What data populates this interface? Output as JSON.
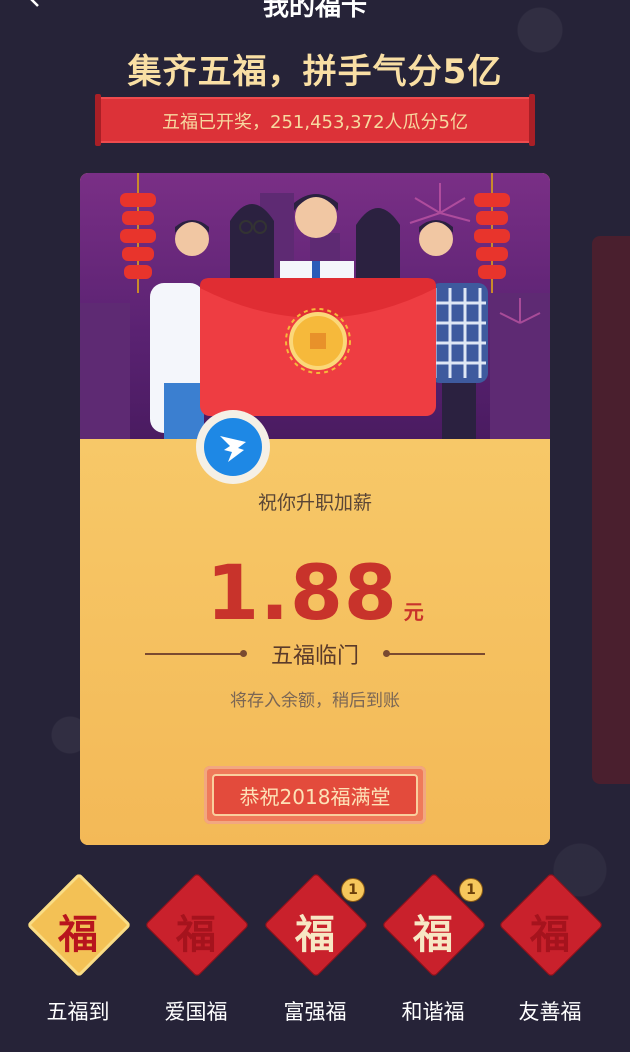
{
  "nav": {
    "title": "我的福卡",
    "back_icon": "chevron-left-icon"
  },
  "headline": "集齐五福，拼手气分5亿",
  "ribbon": "五福已开奖，251,453,372人瓜分5亿",
  "card": {
    "logo_icon": "dingtalk-wing-icon",
    "blessing": "祝你升职加薪",
    "amount": "1.88",
    "unit": "元",
    "subtitle": "五福临门",
    "note": "将存入余额，稍后到账",
    "button": "恭祝2018福满堂"
  },
  "tabs": [
    {
      "label": "五福到",
      "char": "福",
      "badge": "",
      "active": true
    },
    {
      "label": "爱国福",
      "char": "福",
      "badge": ""
    },
    {
      "label": "富强福",
      "char": "福",
      "badge": "1"
    },
    {
      "label": "和谐福",
      "char": "福",
      "badge": "1"
    },
    {
      "label": "友善福",
      "char": "福",
      "badge": ""
    }
  ],
  "colors": {
    "bg": "#262338",
    "accent_red": "#dc3238",
    "gold": "#f9dfa4",
    "amount": "#c8332b"
  }
}
